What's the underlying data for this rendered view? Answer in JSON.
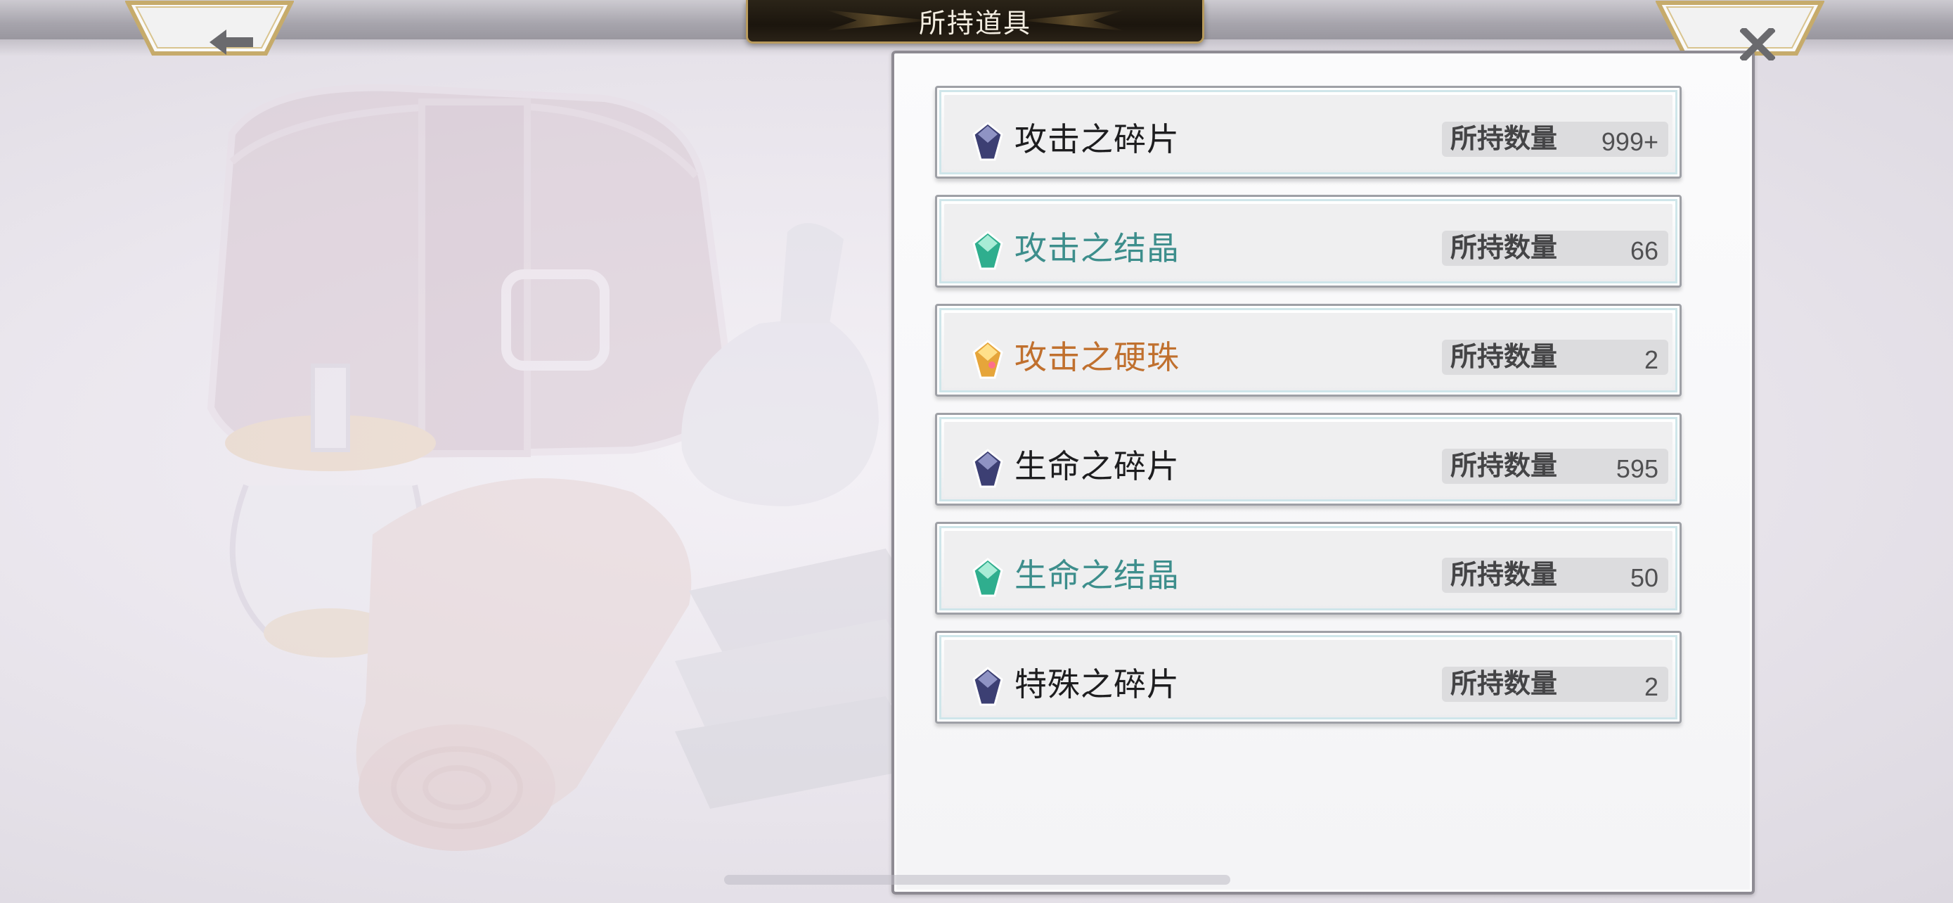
{
  "header": {
    "title": "所持道具",
    "back_icon": "arrow-left-icon",
    "close_icon": "close-x-icon"
  },
  "items": [
    {
      "name": "攻击之碎片",
      "type": "fragment",
      "icon": "gem-fragment-icon",
      "icon_color": "#3c3f73",
      "count_label": "所持数量",
      "count": "999+"
    },
    {
      "name": "攻击之结晶",
      "type": "crystal",
      "icon": "gem-crystal-icon",
      "icon_color": "#2fae8e",
      "count_label": "所持数量",
      "count": "66"
    },
    {
      "name": "攻击之硬珠",
      "type": "orb",
      "icon": "gem-orb-icon",
      "icon_color": "#e6a53a",
      "count_label": "所持数量",
      "count": "2"
    },
    {
      "name": "生命之碎片",
      "type": "fragment",
      "icon": "gem-fragment-icon",
      "icon_color": "#3c3f73",
      "count_label": "所持数量",
      "count": "595"
    },
    {
      "name": "生命之结晶",
      "type": "crystal",
      "icon": "gem-crystal-icon",
      "icon_color": "#2fae8e",
      "count_label": "所持数量",
      "count": "50"
    },
    {
      "name": "特殊之碎片",
      "type": "fragment",
      "icon": "gem-fragment-icon",
      "icon_color": "#3c3f73",
      "count_label": "所持数量",
      "count": "2"
    }
  ],
  "colors": {
    "crystal_text": "#3d8e8c",
    "orb_text": "#c0702e",
    "plate_gold": "#b89b5e"
  }
}
